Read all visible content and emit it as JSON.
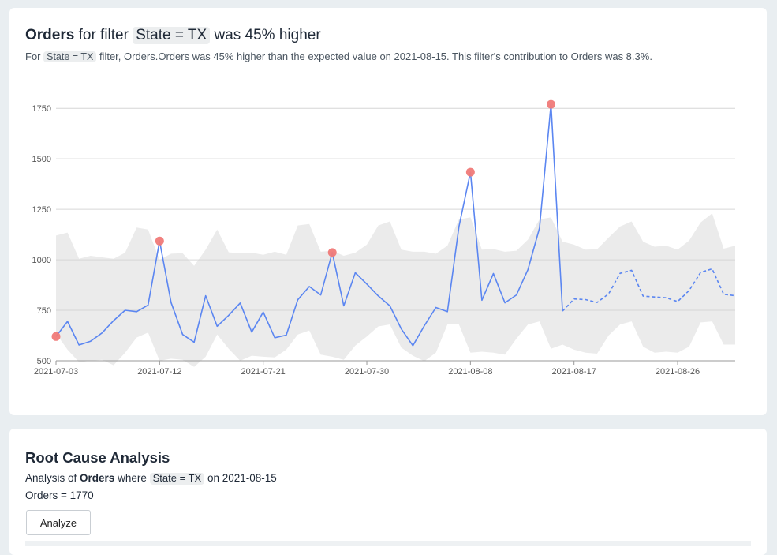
{
  "header": {
    "metric": "Orders",
    "for_filter": "for filter",
    "filter_pill": "State = TX",
    "suffix": "was 45% higher"
  },
  "subtitle": {
    "prefix": "For",
    "filter_pill": "State = TX",
    "text": "filter, Orders.Orders was 45% higher than the expected value on 2021-08-15. This filter's contribution to Orders was 8.3%."
  },
  "colors": {
    "line": "#5b86f1",
    "band": "#ebebeb",
    "anomaly": "#f07a78",
    "grid": "#d6d6d6"
  },
  "chart_data": {
    "type": "line",
    "title": "",
    "xlabel": "",
    "ylabel": "",
    "ylim": [
      500,
      1790
    ],
    "grid": true,
    "y_ticks": [
      500,
      750,
      1000,
      1250,
      1500,
      1750
    ],
    "x_ticks": [
      "2021-07-03",
      "2021-07-12",
      "2021-07-21",
      "2021-07-30",
      "2021-08-08",
      "2021-08-17",
      "2021-08-26"
    ],
    "x_start": "2021-07-03",
    "x_end": "2021-08-31",
    "series": [
      {
        "style": "solid",
        "points": [
          [
            "2021-07-03",
            620
          ],
          [
            "2021-07-04",
            695
          ],
          [
            "2021-07-05",
            578
          ],
          [
            "2021-07-06",
            597
          ],
          [
            "2021-07-07",
            638
          ],
          [
            "2021-07-08",
            699
          ],
          [
            "2021-07-09",
            750
          ],
          [
            "2021-07-10",
            743
          ],
          [
            "2021-07-11",
            776
          ],
          [
            "2021-07-12",
            1093
          ],
          [
            "2021-07-13",
            788
          ],
          [
            "2021-07-14",
            630
          ],
          [
            "2021-07-15",
            592
          ],
          [
            "2021-07-16",
            822
          ],
          [
            "2021-07-17",
            671
          ],
          [
            "2021-07-18",
            725
          ],
          [
            "2021-07-19",
            786
          ],
          [
            "2021-07-20",
            642
          ],
          [
            "2021-07-21",
            741
          ],
          [
            "2021-07-22",
            614
          ],
          [
            "2021-07-23",
            627
          ],
          [
            "2021-07-24",
            802
          ],
          [
            "2021-07-25",
            868
          ],
          [
            "2021-07-26",
            826
          ],
          [
            "2021-07-27",
            1036
          ],
          [
            "2021-07-28",
            772
          ],
          [
            "2021-07-29",
            936
          ],
          [
            "2021-07-30",
            880
          ],
          [
            "2021-07-31",
            821
          ],
          [
            "2021-08-01",
            772
          ],
          [
            "2021-08-02",
            657
          ],
          [
            "2021-08-03",
            575
          ],
          [
            "2021-08-04",
            674
          ],
          [
            "2021-08-05",
            764
          ],
          [
            "2021-08-06",
            743
          ],
          [
            "2021-08-07",
            1164
          ],
          [
            "2021-08-08",
            1434
          ],
          [
            "2021-08-09",
            800
          ],
          [
            "2021-08-10",
            932
          ],
          [
            "2021-08-11",
            787
          ],
          [
            "2021-08-12",
            826
          ],
          [
            "2021-08-13",
            952
          ],
          [
            "2021-08-14",
            1157
          ],
          [
            "2021-08-15",
            1770
          ],
          [
            "2021-08-16",
            746
          ]
        ]
      },
      {
        "style": "dashed",
        "points": [
          [
            "2021-08-16",
            746
          ],
          [
            "2021-08-17",
            806
          ],
          [
            "2021-08-18",
            803
          ],
          [
            "2021-08-19",
            789
          ],
          [
            "2021-08-20",
            831
          ],
          [
            "2021-08-21",
            933
          ],
          [
            "2021-08-22",
            948
          ],
          [
            "2021-08-23",
            820
          ],
          [
            "2021-08-24",
            816
          ],
          [
            "2021-08-25",
            812
          ],
          [
            "2021-08-26",
            793
          ],
          [
            "2021-08-27",
            848
          ],
          [
            "2021-08-28",
            938
          ],
          [
            "2021-08-29",
            955
          ],
          [
            "2021-08-30",
            829
          ],
          [
            "2021-08-31",
            822
          ]
        ]
      }
    ],
    "band": {
      "upper": [
        1120,
        1135,
        1005,
        1020,
        1012,
        1005,
        1035,
        1160,
        1150,
        1000,
        1030,
        1033,
        970,
        1050,
        1150,
        1037,
        1033,
        1035,
        1025,
        1040,
        1025,
        1170,
        1177,
        1040,
        1045,
        1020,
        1035,
        1075,
        1170,
        1190,
        1050,
        1040,
        1040,
        1030,
        1070,
        1200,
        1210,
        1050,
        1053,
        1040,
        1045,
        1100,
        1200,
        1210,
        1090,
        1075,
        1050,
        1052,
        1110,
        1165,
        1190,
        1090,
        1065,
        1070,
        1050,
        1095,
        1185,
        1230,
        1055,
        1070
      ],
      "lower": [
        635,
        555,
        493,
        500,
        505,
        478,
        540,
        615,
        640,
        500,
        510,
        505,
        470,
        520,
        630,
        560,
        500,
        525,
        520,
        517,
        555,
        630,
        650,
        530,
        520,
        505,
        575,
        620,
        670,
        680,
        565,
        525,
        498,
        540,
        680,
        680,
        540,
        545,
        540,
        530,
        610,
        680,
        695,
        560,
        580,
        555,
        540,
        535,
        625,
        680,
        695,
        570,
        540,
        545,
        540,
        570,
        690,
        695,
        580,
        580
      ]
    },
    "anomalies": [
      [
        "2021-07-03",
        620
      ],
      [
        "2021-07-12",
        1093
      ],
      [
        "2021-07-27",
        1036
      ],
      [
        "2021-08-08",
        1434
      ],
      [
        "2021-08-15",
        1770
      ]
    ]
  },
  "rca": {
    "title": "Root Cause Analysis",
    "desc_prefix": "Analysis of",
    "desc_metric": "Orders",
    "desc_where": "where",
    "desc_filter": "State = TX",
    "desc_on": "on 2021-08-15",
    "value_line": "Orders = 1770",
    "button_label": "Analyze"
  }
}
